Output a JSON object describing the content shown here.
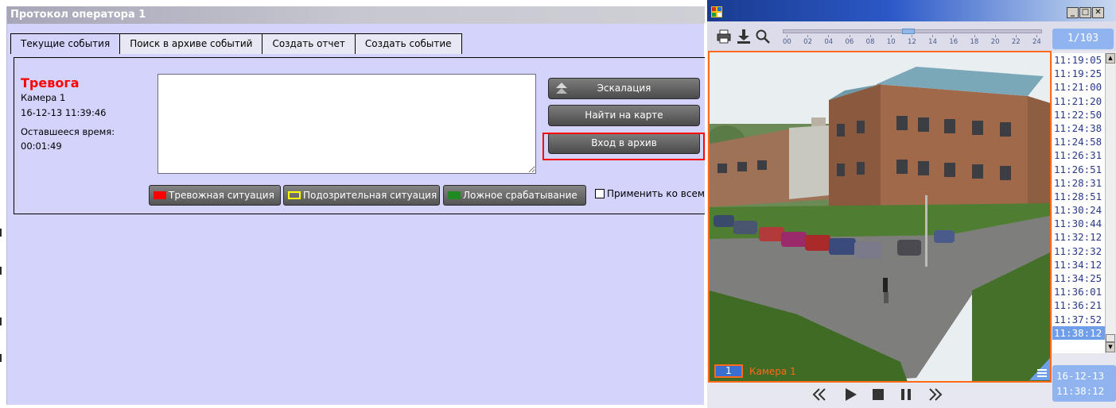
{
  "operator_window": {
    "title": "Протокол оператора 1",
    "tabs": [
      "Текущие события",
      "Поиск в архиве событий",
      "Создать отчет",
      "Создать событие"
    ],
    "alarm": {
      "title": "Тревога",
      "camera": "Камера 1",
      "datetime": "16-12-13 11:39:46",
      "remaining_label": "Оставшееся время:",
      "remaining_value": "00:01:49"
    },
    "buttons": {
      "escalation": "Эскалация",
      "find_on_map": "Найти на карте",
      "enter_archive": "Вход в архив"
    },
    "situations": [
      {
        "label": "Тревожная ситуация",
        "color": "#ff0000"
      },
      {
        "label": "Подозрительная ситуация",
        "color": "#ffff00"
      },
      {
        "label": "Ложное срабатывание",
        "color": "#1f8a1f"
      }
    ],
    "apply_all_label": "Применить ко всем",
    "highlight_color": "#ff0000"
  },
  "video_window": {
    "window_controls": [
      "_",
      "□",
      "✕"
    ],
    "toolbar_icons": [
      "printer-icon",
      "download-icon",
      "search-icon"
    ],
    "timeline_ticks": [
      "00",
      "02",
      "04",
      "06",
      "08",
      "10",
      "12",
      "14",
      "16",
      "18",
      "20",
      "22",
      "24"
    ],
    "page_counter": "1/103",
    "camera_number": "1",
    "camera_name": "Камера 1",
    "time_list": [
      "11:19:05",
      "11:19:25",
      "11:21:00",
      "11:21:20",
      "11:22:50",
      "11:24:38",
      "11:24:58",
      "11:26:31",
      "11:26:51",
      "11:28:31",
      "11:28:51",
      "11:30:24",
      "11:30:44",
      "11:32:12",
      "11:32:32",
      "11:34:12",
      "11:34:25",
      "11:36:01",
      "11:36:21",
      "11:37:52",
      "11:38:12"
    ],
    "selected_time": "11:38:12",
    "date": "16-12-13",
    "time": "11:38:12",
    "playback_controls": [
      "rewind-icon",
      "play-icon",
      "stop-icon",
      "pause-icon",
      "forward-icon"
    ],
    "accent_color": "#ff6a1a"
  }
}
